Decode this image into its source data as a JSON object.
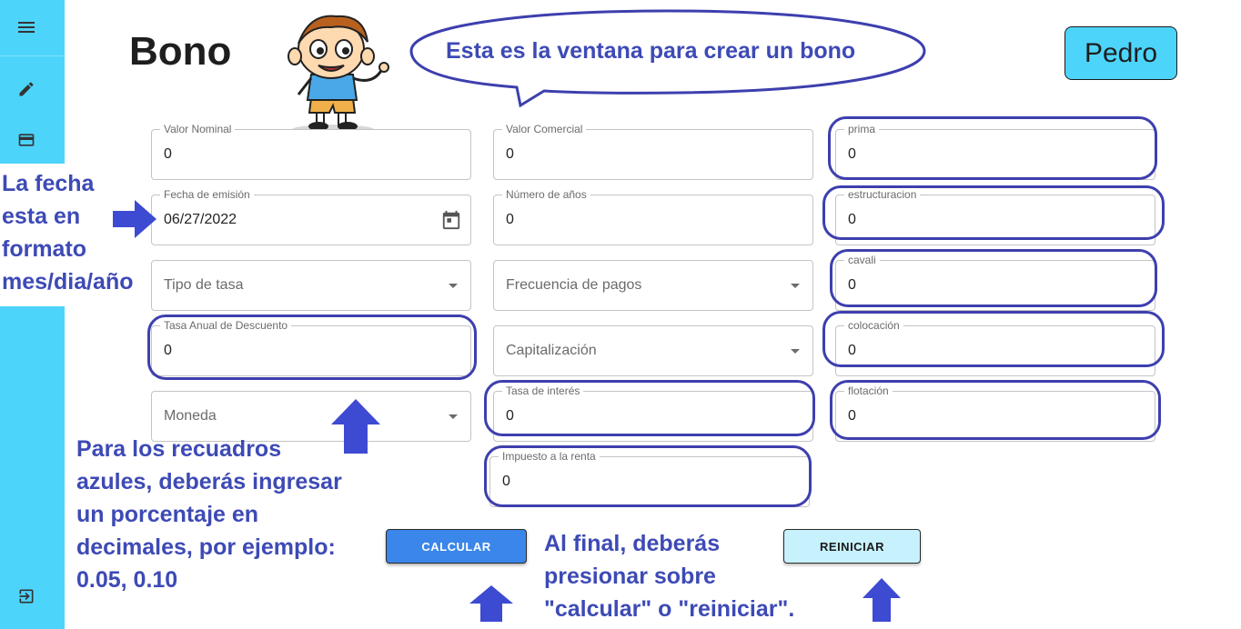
{
  "header": {
    "title": "Bono",
    "user": "Pedro"
  },
  "bubble": {
    "text": "Esta es la ventana para crear un bono"
  },
  "colors": {
    "sidebar": "#4dd4fb",
    "accent": "#3b86ea",
    "annotation": "#3d4ab5",
    "highlight": "#3d3fae",
    "reset_bg": "#c7f1fd"
  },
  "sidebar": {
    "icons": [
      "menu-icon",
      "pencil-icon",
      "credit-card-icon",
      "logout-icon"
    ]
  },
  "fields": {
    "valor_nominal": {
      "label": "Valor Nominal",
      "value": "0"
    },
    "fecha_emision": {
      "label": "Fecha de emisión",
      "value": "06/27/2022"
    },
    "tipo_tasa": {
      "placeholder": "Tipo de tasa"
    },
    "tasa_descuento": {
      "label": "Tasa Anual de Descuento",
      "value": "0"
    },
    "moneda": {
      "placeholder": "Moneda"
    },
    "valor_comercial": {
      "label": "Valor Comercial",
      "value": "0"
    },
    "numero_anios": {
      "label": "Número de años",
      "value": "0"
    },
    "frecuencia_pagos": {
      "placeholder": "Frecuencia de pagos"
    },
    "capitalizacion": {
      "placeholder": "Capitalización"
    },
    "tasa_interes": {
      "label": "Tasa de interés",
      "value": "0"
    },
    "impuesto_renta": {
      "label": "Impuesto a la renta",
      "value": "0"
    },
    "prima": {
      "label": "prima",
      "value": "0"
    },
    "estructuracion": {
      "label": "estructuracion",
      "value": "0"
    },
    "cavali": {
      "label": "cavali",
      "value": "0"
    },
    "colocacion": {
      "label": "colocación",
      "value": "0"
    },
    "flotacion": {
      "label": "flotación",
      "value": "0"
    }
  },
  "buttons": {
    "calcular": "CALCULAR",
    "reiniciar": "REINICIAR"
  },
  "notes": {
    "date": [
      "La fecha",
      "esta en",
      "formato",
      "mes/dia/año"
    ],
    "blue_boxes": [
      "Para los recuadros",
      "azules, deberás ingresar",
      "un porcentaje en",
      "decimales, por ejemplo:",
      "0.05, 0.10"
    ],
    "final": [
      "Al final, deberás",
      "presionar sobre",
      "\"calcular\" o \"reiniciar\"."
    ]
  }
}
